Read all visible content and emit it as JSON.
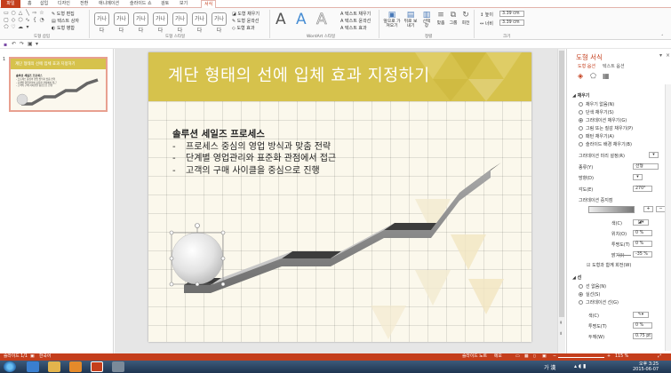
{
  "ribbon_tabs": [
    "파일",
    "홈",
    "삽입",
    "디자인",
    "전환",
    "애니메이션",
    "슬라이드 쇼",
    "검토",
    "보기",
    "서식"
  ],
  "active_tab_index": 9,
  "ribbon": {
    "shape_insert_group": "도형 삽입",
    "edit_shape": "도형 편집",
    "text_box": "텍스트 상자",
    "merge_shapes": "도형 병합",
    "shape_styles_group": "도형 스타일",
    "style_sample": "가나다",
    "shape_fill": "도형 채우기",
    "shape_outline": "도형 윤곽선",
    "shape_effects": "도형 효과",
    "wordart_group": "WordArt 스타일",
    "wordart_letter": "A",
    "text_fill": "텍스트 채우기",
    "text_outline": "텍스트 윤곽선",
    "text_effects": "텍스트 효과",
    "arrange_group": "정렬",
    "bring_forward": "앞으로 가져오기",
    "send_backward": "뒤로 보내기",
    "selection_pane": "선택 창",
    "align": "맞춤",
    "group": "그룹",
    "rotate": "회전",
    "size_group": "크기",
    "height_label": "높이",
    "height_value": "3.39 cm",
    "width_label": "너비",
    "width_value": "3.39 cm"
  },
  "thumbnail": {
    "number": "1",
    "title": "계단 형태의 선에 입체 효과 지정하기",
    "heading": "솔루션 세일즈 프로세스",
    "lines": [
      "- 프로세스 중심의 영업 방식과 맞춤 전략",
      "- 단계별 영업관리와 표준화 관점에서 접근",
      "- 고객의 구매 사이클을 중심으로 진행"
    ]
  },
  "slide": {
    "title": "계단 형태의 선에 입체 효과 지정하기",
    "heading": "솔루션 세일즈 프로세스",
    "bullets": [
      {
        "dash": "-",
        "text": "프로세스 중심의 영업 방식과 맞춤 전략"
      },
      {
        "dash": "-",
        "text": "단계별 영업관리와 표준화 관점에서 접근"
      },
      {
        "dash": "-",
        "text": "고객의 구매 사이클을 중심으로 진행"
      }
    ]
  },
  "panel": {
    "title": "도형 서식",
    "tab_shape_options": "도형 옵션",
    "tab_text_options": "텍스트 옵션",
    "fill_section": "채우기",
    "fill_options": [
      "채우기 없음(N)",
      "단색 채우기(S)",
      "그라데이션 채우기(G)",
      "그림 또는 질감 채우기(P)",
      "패턴 채우기(A)",
      "슬라이드 배경 채우기(B)"
    ],
    "fill_selected_index": 2,
    "preset_gradient": "그라데이션 미리 설정(R)",
    "type_label": "종류(Y)",
    "type_value": "선형",
    "direction_label": "방향(D)",
    "angle_label": "각도(E)",
    "angle_value": "270°",
    "gradient_stops_label": "그라데이션 중지점",
    "color_label": "색(C)",
    "position_label": "위치(O)",
    "position_value": "0 %",
    "transparency_label": "투명도(T)",
    "transparency_value": "0 %",
    "brightness_label": "밝기(I)",
    "brightness_value": "-35 %",
    "rotate_with_shape": "도형과 함께 회전(W)",
    "line_section": "선",
    "line_options": [
      "선 없음(N)",
      "실선(S)",
      "그라데이션 선(G)"
    ],
    "line_selected_index": 1,
    "line_color_label": "색(C)",
    "line_transparency_label": "투명도(T)",
    "line_transparency_value": "0 %",
    "line_width_label": "두께(W)",
    "line_width_value": "0.75 pt"
  },
  "status": {
    "slide_count": "슬라이드 1/1",
    "language": "한국어",
    "notes": "슬라이드 노트",
    "comments": "메모",
    "zoom": "115 %"
  },
  "taskbar": {
    "time": "오후 3:25",
    "date": "2015-06-07",
    "ime": "가 漢"
  },
  "colors": {
    "accent": "#c43e1c",
    "title_band": "#d6c24c",
    "slide_bg": "#fbf8ec"
  }
}
